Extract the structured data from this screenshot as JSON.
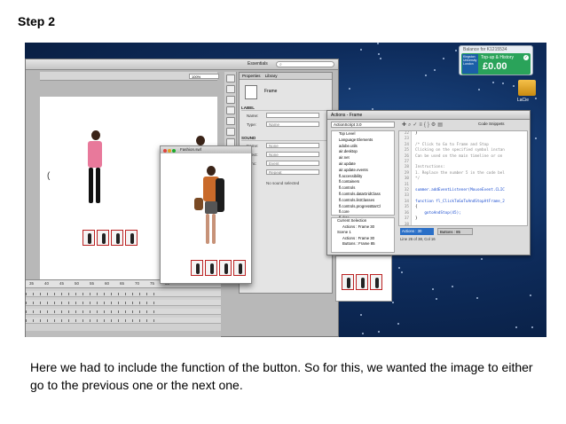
{
  "step_title": "Step 2",
  "caption": "Here we had to include the function of the button. So for this, we wanted the image to either go to the previous one or the next one.",
  "desktop": {
    "balance": {
      "title": "Balance for K1215534",
      "university": "Kingston University London",
      "topup_label": "Top-up & History",
      "amount": "£0.00"
    },
    "drive_label": "LaCie"
  },
  "flash": {
    "workspace": "Essentials",
    "zoom": "100%",
    "properties": {
      "tabs": [
        "Properties",
        "Library"
      ],
      "frame_label": "Frame",
      "label_section": "LABEL",
      "name_label": "Name:",
      "type_label": "Type:",
      "type_value": "Name",
      "sound_section": "SOUND",
      "sound_name_label": "Name:",
      "sound_name_value": "None",
      "effect_label": "Effect:",
      "effect_value": "None",
      "sync_label": "Sync:",
      "sync_value": "Event",
      "repeat_value": "Repeat",
      "no_sound": "No sound selected"
    },
    "timeline_ruler": [
      "35",
      "40",
      "45",
      "50",
      "55",
      "60",
      "65",
      "70",
      "75",
      "80"
    ],
    "photo_title": "Fashion.swf"
  },
  "actions_panel": {
    "title": "Actions - Frame",
    "language": "ActionScript 3.0",
    "snippets": "Code Snippets",
    "tree": [
      "Top Level",
      "Language Elements",
      "adobe.utils",
      "air.desktop",
      "air.net",
      "air.update",
      "air.update.events",
      "fl.accessibility",
      "fl.containers",
      "fl.controls",
      "fl.controls.dataGridClass",
      "fl.controls.listClasses",
      "fl.controls.progressBarCl",
      "fl.core",
      "fl.data"
    ],
    "current_selection": [
      "Current Selection",
      "Actions : Frame 30",
      "Scene 1",
      "Actions : Frame 30",
      "Buttons : Frame 85"
    ],
    "gutter": [
      "22",
      "23",
      "24",
      "25",
      "26",
      "27",
      "28",
      "29",
      "30",
      "31",
      "32",
      "33",
      "34",
      "35",
      "36",
      "37",
      "38"
    ],
    "code": [
      "}",
      "",
      "/* Click to Go to Frame and Stop",
      "Clicking on the specified symbol instan",
      "Can be used on the main timeline or on",
      "",
      "Instructions:",
      "1. Replace the number 5 in the code bel",
      "*/",
      "",
      "summer.addEventListener(MouseEvent.CLIC",
      "",
      "function fl_ClickToGoToAndStopAtFrame_2",
      "{",
      "    gotoAndStop(45);",
      "}",
      ""
    ],
    "tab_active": "Actions : 30",
    "tab_other": "Buttons : 85",
    "line_col": "Line 26 of 38, Col 16"
  }
}
